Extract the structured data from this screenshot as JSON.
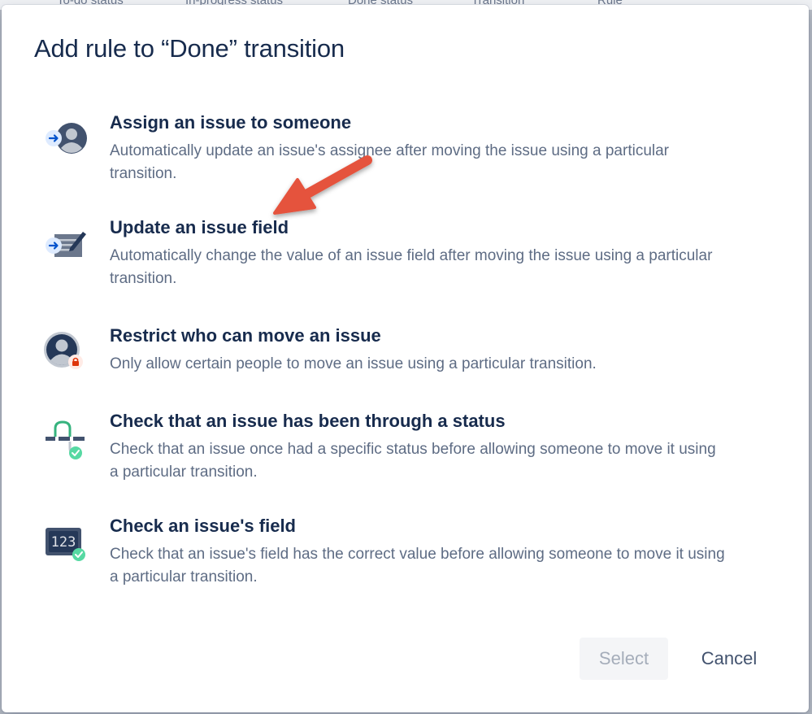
{
  "background_header": {
    "columns": [
      "To-do status",
      "In-progress status",
      "Done status",
      "Transition",
      "Rule"
    ]
  },
  "modal": {
    "title": "Add rule to “Done” transition",
    "options": [
      {
        "icon": "assign-user-icon",
        "title": "Assign an issue to someone",
        "description": "Automatically update an issue's assignee after moving the issue using a particular transition."
      },
      {
        "icon": "edit-field-icon",
        "title": "Update an issue field",
        "description": "Automatically change the value of an issue field after moving the issue using a particular transition."
      },
      {
        "icon": "restricted-user-icon",
        "title": "Restrict who can move an issue",
        "description": "Only allow certain people to move an issue using a particular transition."
      },
      {
        "icon": "status-path-check-icon",
        "title": "Check that an issue has been through a status",
        "description": "Check that an issue once had a specific status before allowing someone to move it using a particular transition."
      },
      {
        "icon": "field-value-check-icon",
        "title": "Check an issue's field",
        "description": "Check that an issue's field has the correct value before allowing someone to move it using a particular transition."
      }
    ],
    "buttons": {
      "select_label": "Select",
      "cancel_label": "Cancel"
    },
    "annotation": "red-arrow-pointing-to-update-field"
  },
  "colors": {
    "title_text": "#172b4d",
    "description_text": "#5e6c84",
    "annotation_arrow": "#e5533d",
    "check_green": "#57d9a3",
    "icon_blue": "#4c9aff"
  }
}
